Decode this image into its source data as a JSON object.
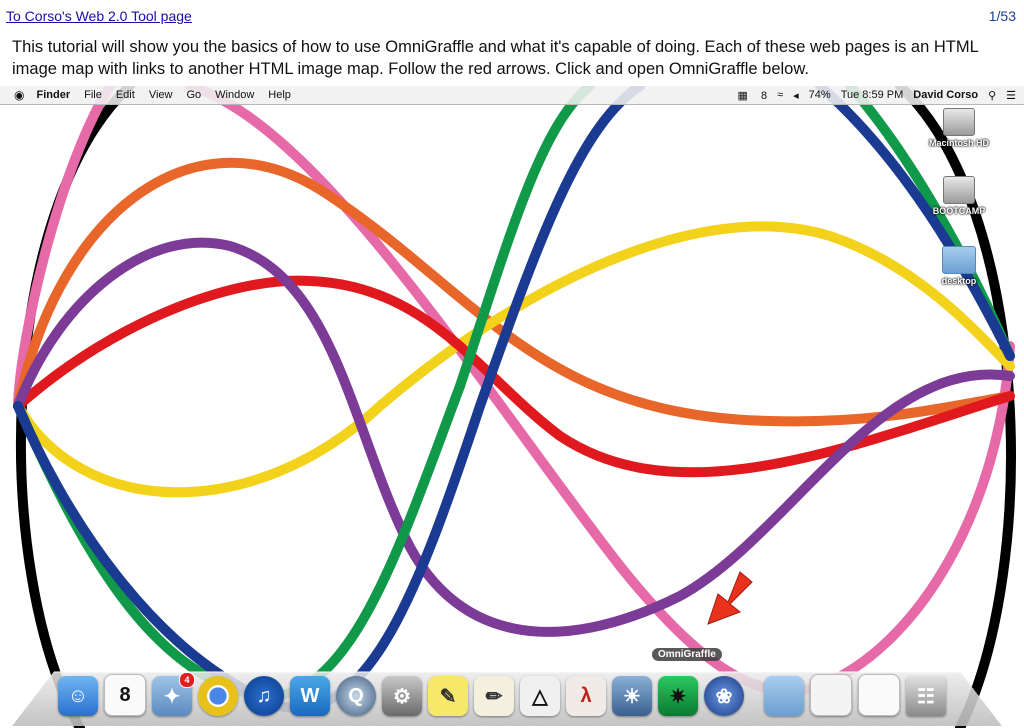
{
  "header": {
    "back_link": "To Corso's Web 2.0 Tool page",
    "page_counter": "1/53"
  },
  "intro": {
    "text": "This tutorial will show you the basics of how to use OmniGraffle and what it's capable of doing. Each of these web pages is an HTML image map with links to another HTML image map. Follow the red arrows. Click and open OmniGraffle below."
  },
  "menubar": {
    "apple_icon": "apple-logo",
    "app": "Finder",
    "items": [
      "File",
      "Edit",
      "View",
      "Go",
      "Window",
      "Help"
    ],
    "right": {
      "badge": "8",
      "battery": "74%",
      "time": "Tue 8:59 PM",
      "user": "David Corso"
    }
  },
  "desktop_icons": [
    {
      "label": "Macintosh HD",
      "icon": "hard-drive-icon"
    },
    {
      "label": "BOOTCAMP",
      "icon": "hard-drive-icon"
    },
    {
      "label": "desktop",
      "icon": "folder-icon"
    }
  ],
  "dock": {
    "tooltip": "OmniGraffle",
    "calendar_day": "8",
    "mail_badge": "4",
    "items": [
      "finder-icon",
      "calendar-icon",
      "mail-icon",
      "chrome-icon",
      "itunes-icon",
      "word-icon",
      "quicktime-icon",
      "system-preferences-icon",
      "stickies-icon",
      "textedit-icon",
      "unity-icon",
      "acrobat-icon",
      "iphoto-icon",
      "omnigraffle-icon",
      "sketchbook-icon",
      "folder-icon",
      "preview-icon",
      "documents-icon",
      "trash-icon"
    ]
  },
  "colors": {
    "curve_black": "#000000",
    "curve_pink": "#e76aa8",
    "curve_orange": "#e8662a",
    "curve_yellow": "#f2d21a",
    "curve_red": "#e0191e",
    "curve_purple": "#7b3b96",
    "curve_green": "#11994a",
    "curve_blue": "#1b3b92",
    "arrow": "#e8321c"
  }
}
